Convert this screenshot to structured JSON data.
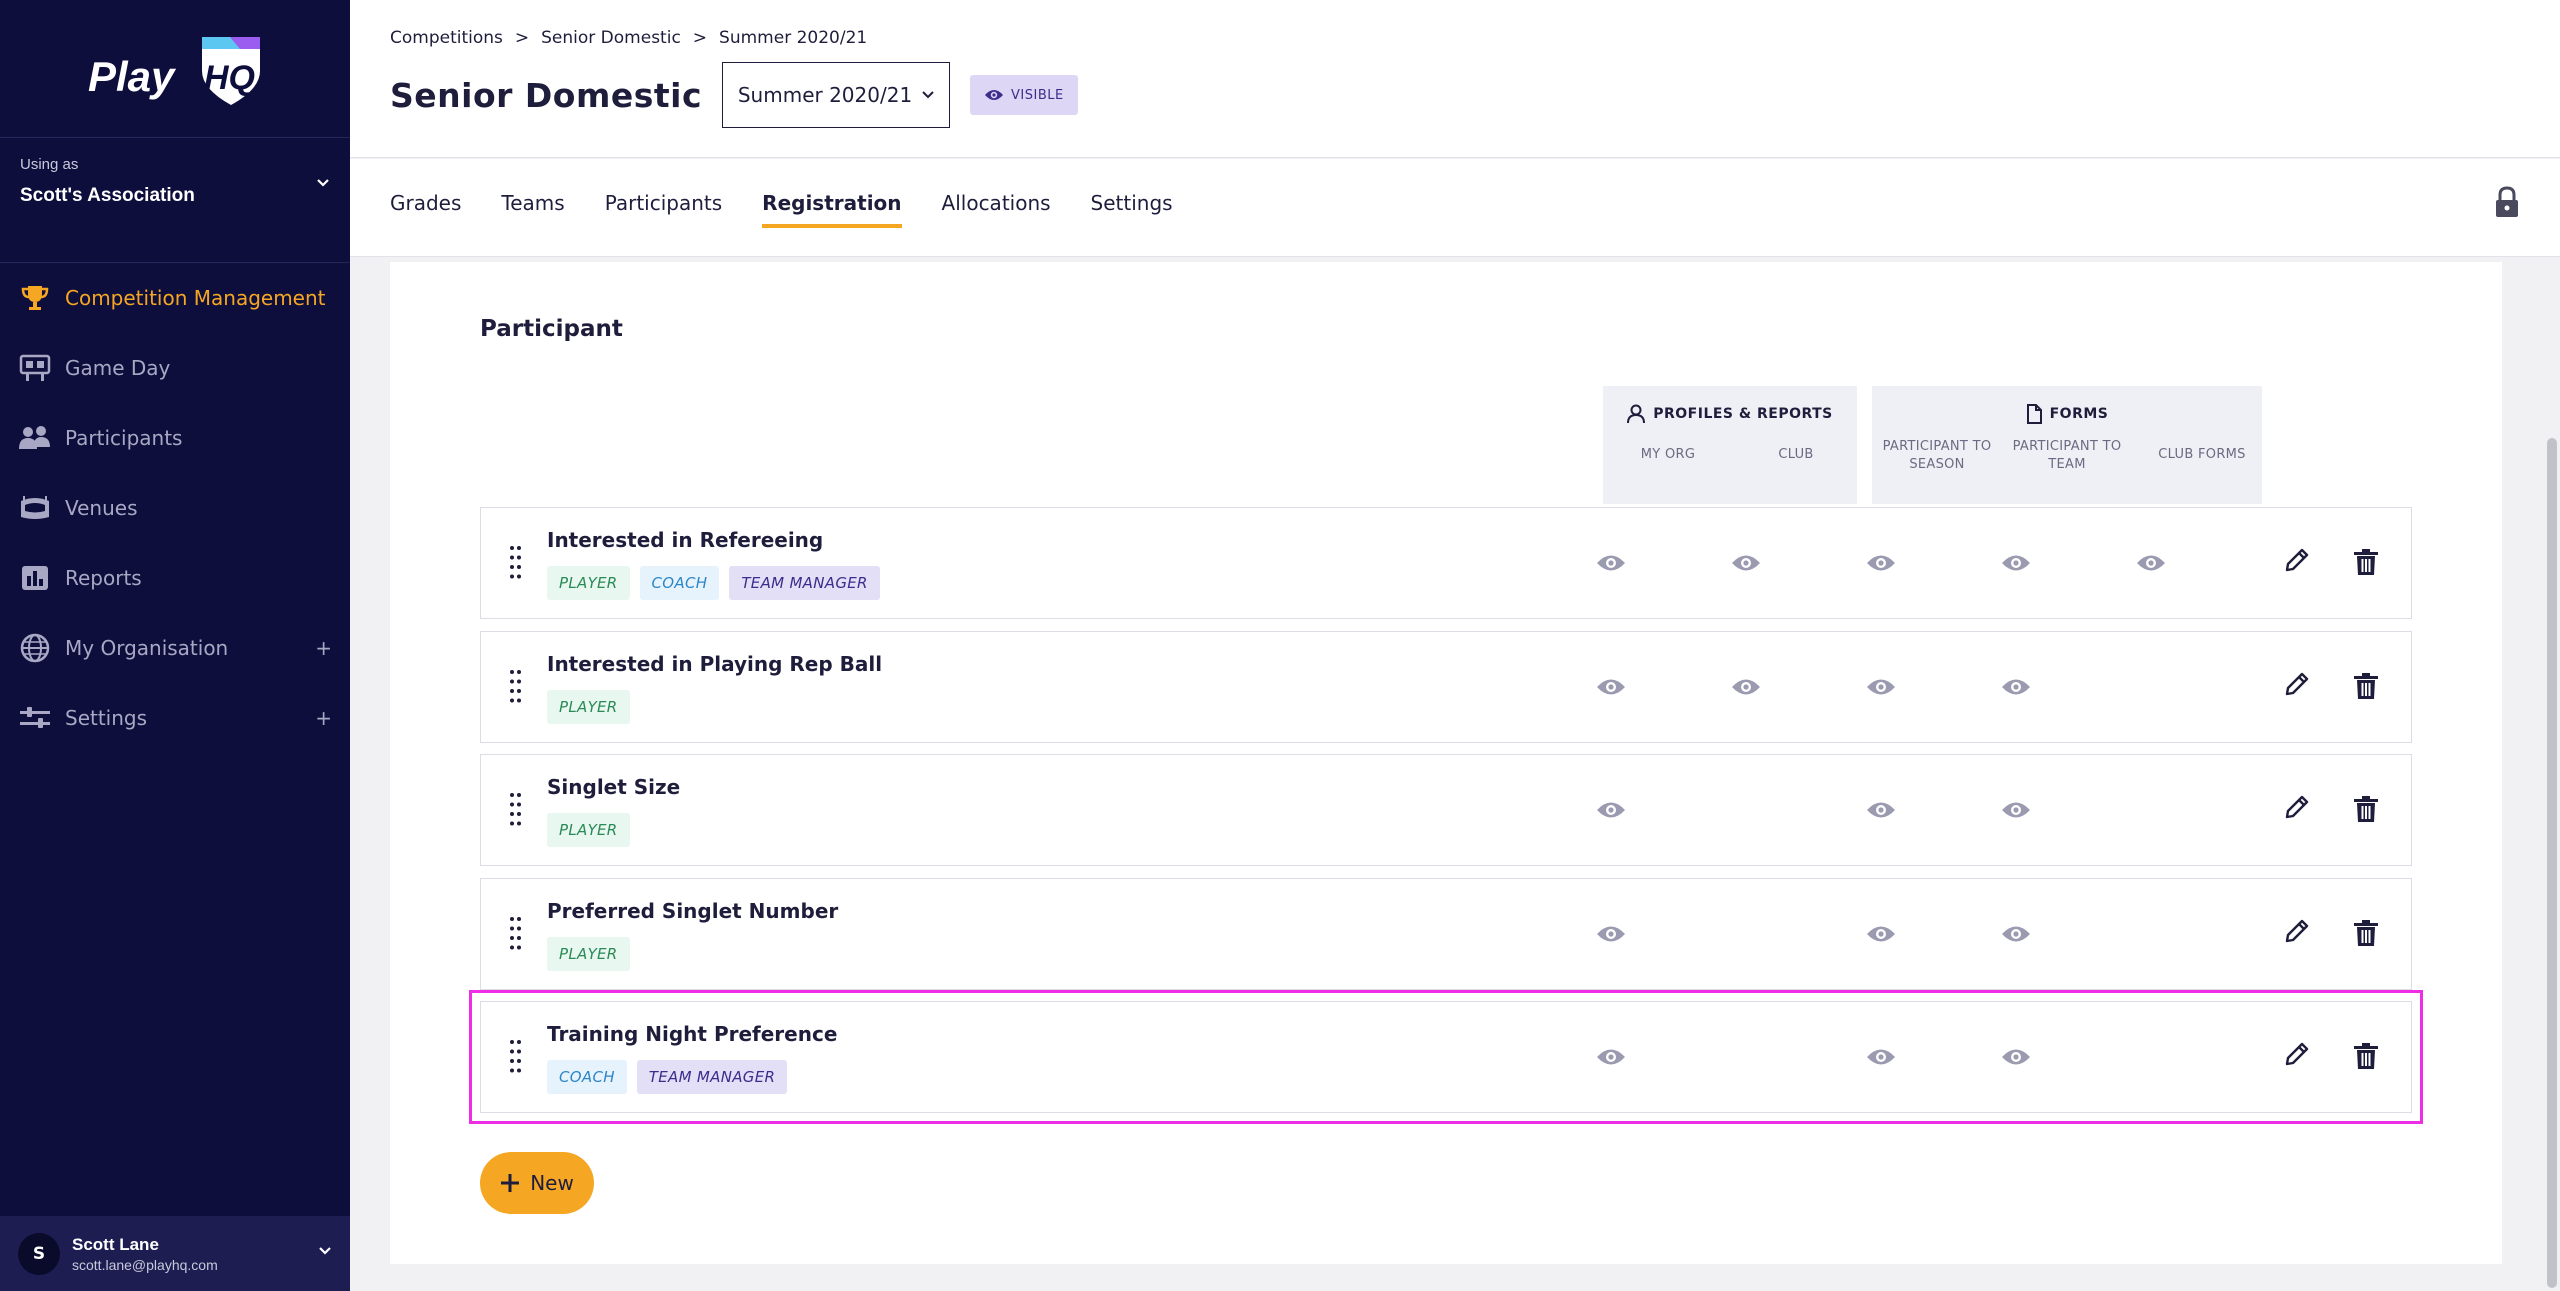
{
  "brand": {
    "logo_text": "Play",
    "logo_mark": "HQ",
    "accent": "#f5a623"
  },
  "sidebar": {
    "using_as_label": "Using as",
    "using_as_name": "Scott's Association",
    "items": [
      {
        "label": "Competition Management",
        "icon": "trophy-icon",
        "active": true
      },
      {
        "label": "Game Day",
        "icon": "scoreboard-icon"
      },
      {
        "label": "Participants",
        "icon": "people-icon"
      },
      {
        "label": "Venues",
        "icon": "stadium-icon"
      },
      {
        "label": "Reports",
        "icon": "chart-icon"
      },
      {
        "label": "My Organisation",
        "icon": "globe-icon",
        "expandable": true
      },
      {
        "label": "Settings",
        "icon": "sliders-icon",
        "expandable": true
      }
    ],
    "user": {
      "initial": "S",
      "name": "Scott Lane",
      "email": "scott.lane@playhq.com"
    }
  },
  "header": {
    "breadcrumb": [
      "Competitions",
      "Senior Domestic",
      "Summer 2020/21"
    ],
    "title": "Senior Domestic",
    "season": "Summer 2020/21",
    "visibility": "VISIBLE"
  },
  "tabs": [
    {
      "label": "Grades"
    },
    {
      "label": "Teams"
    },
    {
      "label": "Participants"
    },
    {
      "label": "Registration",
      "active": true
    },
    {
      "label": "Allocations"
    },
    {
      "label": "Settings"
    }
  ],
  "section": {
    "title": "Participant",
    "groups": [
      {
        "title": "PROFILES & REPORTS",
        "icon": "person-icon",
        "columns": [
          "MY ORG",
          "CLUB"
        ]
      },
      {
        "title": "FORMS",
        "icon": "document-icon",
        "columns": [
          "PARTICIPANT TO SEASON",
          "PARTICIPANT TO TEAM",
          "CLUB FORMS"
        ]
      }
    ],
    "rows": [
      {
        "title": "Interested in Refereeing",
        "tags": [
          "PLAYER",
          "COACH",
          "TEAM MANAGER"
        ],
        "visibility": [
          true,
          true,
          true,
          true,
          true
        ]
      },
      {
        "title": "Interested in Playing Rep Ball",
        "tags": [
          "PLAYER"
        ],
        "visibility": [
          true,
          true,
          true,
          true,
          false
        ]
      },
      {
        "title": "Singlet Size",
        "tags": [
          "PLAYER"
        ],
        "visibility": [
          true,
          false,
          true,
          true,
          false
        ]
      },
      {
        "title": "Preferred Singlet Number",
        "tags": [
          "PLAYER"
        ],
        "visibility": [
          true,
          false,
          true,
          true,
          false
        ]
      },
      {
        "title": "Training Night Preference",
        "tags": [
          "COACH",
          "TEAM MANAGER"
        ],
        "visibility": [
          true,
          false,
          true,
          true,
          false
        ],
        "highlighted": true
      }
    ],
    "new_label": "New"
  }
}
